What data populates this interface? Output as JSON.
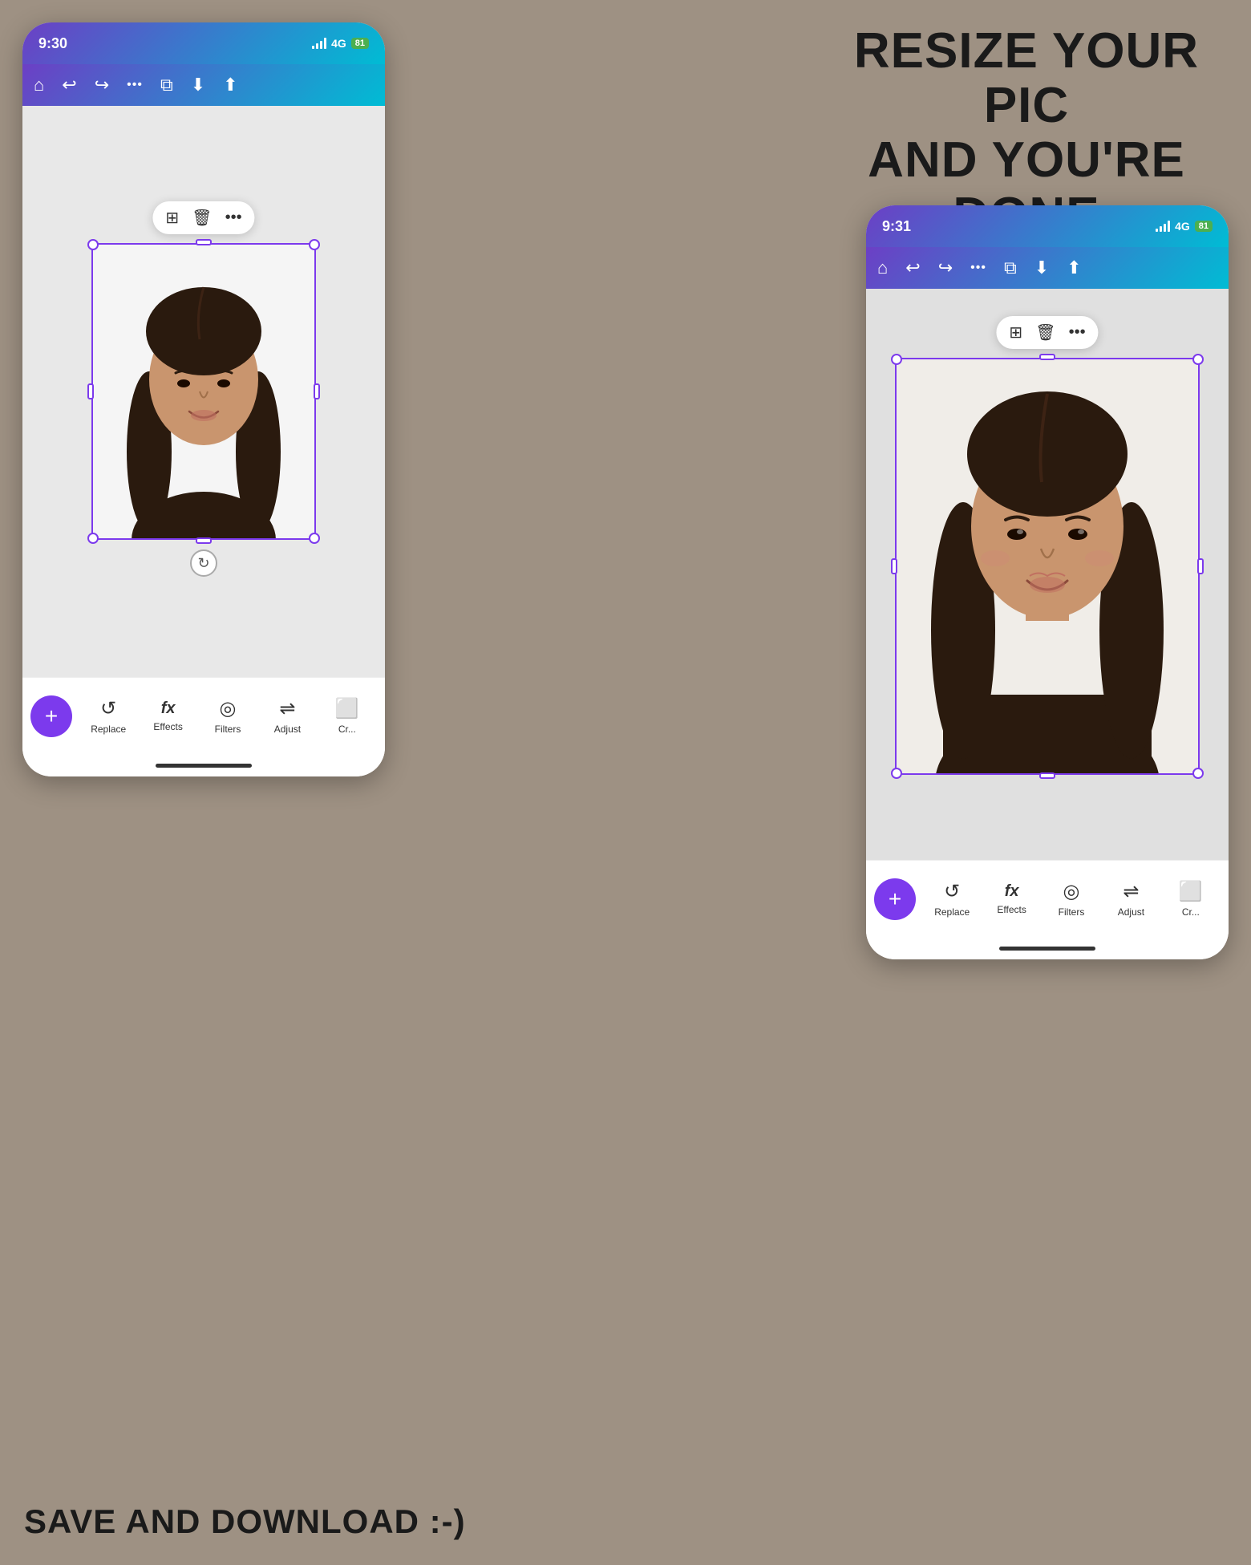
{
  "heading": {
    "line1": "RESIZE YOUR PIC",
    "line2": "AND YOU'RE DONE",
    "line3": "!"
  },
  "bottom_text": "SAVE AND DOWNLOAD :-)",
  "phone_left": {
    "status": {
      "time": "9:30",
      "signal": "4G",
      "battery": "81"
    },
    "toolbar": {
      "icons": [
        "home",
        "undo",
        "redo",
        "more",
        "layers",
        "download",
        "share"
      ]
    },
    "floating_toolbar": {
      "icons": [
        "copy",
        "trash",
        "more"
      ]
    },
    "bottom_tools": [
      {
        "icon": "↺",
        "label": "Replace"
      },
      {
        "icon": "fx",
        "label": "Effects"
      },
      {
        "icon": "⊙",
        "label": "Filters"
      },
      {
        "icon": "⇌",
        "label": "Adjust"
      },
      {
        "icon": "⬜",
        "label": "Cr..."
      }
    ]
  },
  "phone_right": {
    "status": {
      "time": "9:31",
      "signal": "4G",
      "battery": "81"
    },
    "toolbar": {
      "icons": [
        "home",
        "undo",
        "redo",
        "more",
        "layers",
        "download",
        "share"
      ]
    },
    "floating_toolbar": {
      "icons": [
        "copy",
        "trash",
        "more"
      ]
    },
    "bottom_tools": [
      {
        "icon": "↺",
        "label": "Replace"
      },
      {
        "icon": "fx",
        "label": "Effects"
      },
      {
        "icon": "⊙",
        "label": "Filters"
      },
      {
        "icon": "⇌",
        "label": "Adjust"
      },
      {
        "icon": "⬜",
        "label": "Cr..."
      }
    ]
  }
}
